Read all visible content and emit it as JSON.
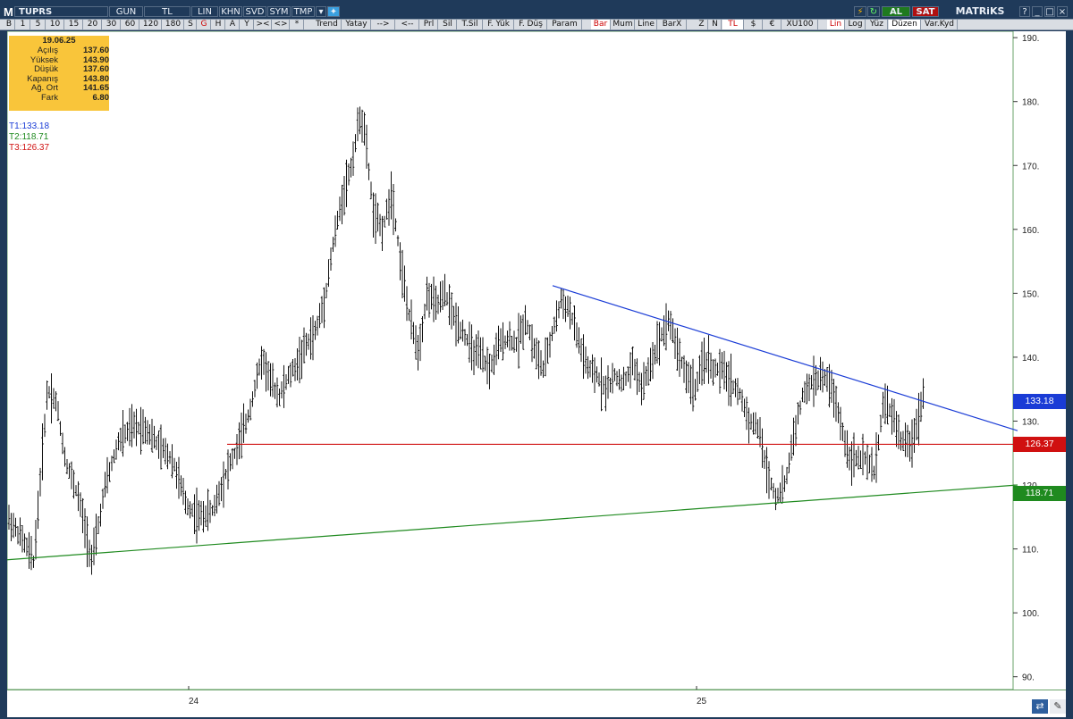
{
  "title": {
    "ticker": "TUPRS",
    "logo": "M",
    "brand": "MATRiKS",
    "al": "AL",
    "sat": "SAT"
  },
  "titlebar_cells": [
    "GUN",
    "TL",
    "LIN",
    "KHN",
    "SVD",
    "SYM",
    "TMP"
  ],
  "toolbar": [
    "B",
    "1",
    "5",
    "10",
    "15",
    "20",
    "30",
    "60",
    "120",
    "180",
    "S",
    "G",
    "H",
    "A",
    "Y",
    "><",
    "<>",
    "*",
    "Trend",
    "Yatay",
    "-->",
    "<--",
    "Prl",
    "Sil",
    "T.Sil",
    "F. Yük",
    "F. Düş",
    "Param",
    "Bar",
    "Mum",
    "Line",
    "BarX",
    "Z",
    "N",
    "TL",
    "$",
    "€",
    "XU100",
    "Lin",
    "Log",
    "Yüz",
    "Düzen",
    "Var.Kyd"
  ],
  "info": {
    "date": "19.06.25",
    "rows": [
      {
        "k": "Açılış",
        "v": "137.60"
      },
      {
        "k": "Yüksek",
        "v": "143.90"
      },
      {
        "k": "Düşük",
        "v": "137.60"
      },
      {
        "k": "Kapanış",
        "v": "143.80"
      },
      {
        "k": "Ağ. Ort",
        "v": "141.65"
      },
      {
        "k": "Fark",
        "v": "6.80"
      }
    ]
  },
  "trend_labels": [
    {
      "text": "T1:133.18",
      "color": "#1a3cd6"
    },
    {
      "text": "T2:118.71",
      "color": "#1f8a1f"
    },
    {
      "text": "T3:126.37",
      "color": "#d01010"
    }
  ],
  "price_tags": [
    {
      "text": "133.18",
      "value": 133.18,
      "color": "#1a3cd6"
    },
    {
      "text": "126.37",
      "value": 126.37,
      "color": "#d01010"
    },
    {
      "text": "118.71",
      "value": 118.71,
      "color": "#1f8a1f"
    }
  ],
  "chart_data": {
    "type": "bar",
    "y_ticks": [
      "90.",
      "100.",
      "110.",
      "120.",
      "130.",
      "140.",
      "150.",
      "160.",
      "170.",
      "180.",
      "190."
    ],
    "x_ticks": [
      "24",
      "25"
    ],
    "ylim": [
      88,
      191
    ],
    "points": [
      [
        0,
        115
      ],
      [
        15,
        112
      ],
      [
        30,
        108
      ],
      [
        45,
        135
      ],
      [
        55,
        133
      ],
      [
        65,
        124
      ],
      [
        80,
        118
      ],
      [
        95,
        108
      ],
      [
        110,
        120
      ],
      [
        125,
        127
      ],
      [
        140,
        129
      ],
      [
        155,
        129
      ],
      [
        170,
        126
      ],
      [
        185,
        124
      ],
      [
        200,
        117
      ],
      [
        215,
        115
      ],
      [
        230,
        116
      ],
      [
        245,
        122
      ],
      [
        258,
        126
      ],
      [
        270,
        131
      ],
      [
        285,
        140
      ],
      [
        295,
        136
      ],
      [
        305,
        134
      ],
      [
        315,
        137
      ],
      [
        325,
        139
      ],
      [
        335,
        142
      ],
      [
        345,
        144
      ],
      [
        355,
        149
      ],
      [
        365,
        158
      ],
      [
        375,
        165
      ],
      [
        385,
        170
      ],
      [
        395,
        178
      ],
      [
        400,
        175
      ],
      [
        410,
        162
      ],
      [
        420,
        160
      ],
      [
        430,
        166
      ],
      [
        440,
        155
      ],
      [
        450,
        146
      ],
      [
        460,
        141
      ],
      [
        470,
        150
      ],
      [
        480,
        148
      ],
      [
        490,
        150
      ],
      [
        500,
        146
      ],
      [
        510,
        144
      ],
      [
        520,
        141
      ],
      [
        530,
        140
      ],
      [
        540,
        138
      ],
      [
        550,
        142
      ],
      [
        560,
        143
      ],
      [
        570,
        142
      ],
      [
        580,
        146
      ],
      [
        590,
        141
      ],
      [
        600,
        138
      ],
      [
        610,
        144
      ],
      [
        620,
        149
      ],
      [
        630,
        147
      ],
      [
        640,
        142
      ],
      [
        650,
        138
      ],
      [
        660,
        137
      ],
      [
        670,
        135
      ],
      [
        680,
        137
      ],
      [
        690,
        136
      ],
      [
        700,
        139
      ],
      [
        710,
        135
      ],
      [
        720,
        139
      ],
      [
        730,
        143
      ],
      [
        740,
        146
      ],
      [
        750,
        141
      ],
      [
        760,
        137
      ],
      [
        770,
        135
      ],
      [
        780,
        140
      ],
      [
        790,
        138
      ],
      [
        800,
        138
      ],
      [
        810,
        136
      ],
      [
        820,
        134
      ],
      [
        830,
        130
      ],
      [
        840,
        129
      ],
      [
        850,
        122
      ],
      [
        860,
        118
      ],
      [
        870,
        120
      ],
      [
        880,
        128
      ],
      [
        890,
        134
      ],
      [
        900,
        136
      ],
      [
        910,
        137
      ],
      [
        920,
        136
      ],
      [
        930,
        131
      ],
      [
        940,
        125
      ],
      [
        950,
        124
      ],
      [
        960,
        124
      ],
      [
        970,
        122
      ],
      [
        980,
        133
      ],
      [
        990,
        131
      ],
      [
        1000,
        127
      ],
      [
        1010,
        126
      ],
      [
        1020,
        131
      ],
      [
        1027,
        136
      ],
      [
        1033,
        142
      ]
    ],
    "trendlines": [
      {
        "x1": 610,
        "y1": 151.2,
        "x2": 1130,
        "y2": 128.5,
        "color": "#1a3cd6"
      },
      {
        "x1": 0,
        "y1": 108.3,
        "x2": 1130,
        "y2": 120.0,
        "color": "#1f8a1f"
      },
      {
        "x1": 246,
        "y1": 126.37,
        "x2": 1130,
        "y2": 126.37,
        "color": "#d01010"
      }
    ]
  }
}
